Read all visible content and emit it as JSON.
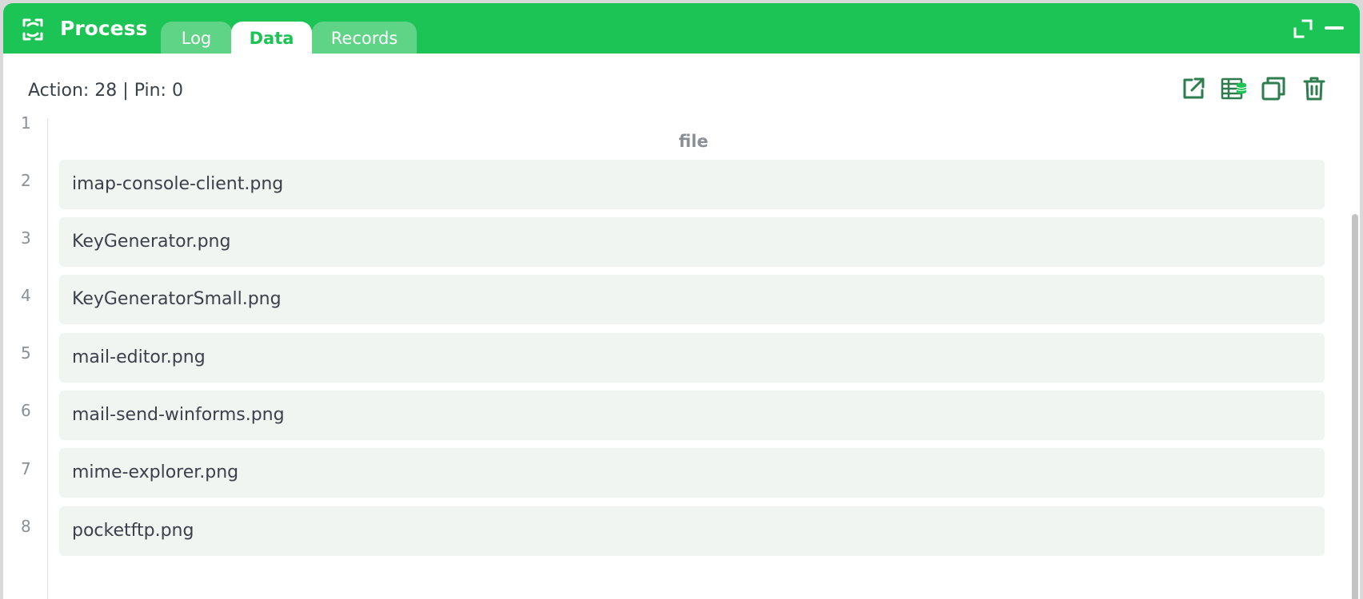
{
  "window": {
    "title": "Process",
    "app_icon": "refresh-arrows-icon",
    "controls": [
      "expand-icon",
      "minimize-icon"
    ]
  },
  "tabs": [
    {
      "label": "Log",
      "active": false
    },
    {
      "label": "Data",
      "active": true
    },
    {
      "label": "Records",
      "active": false
    }
  ],
  "status": {
    "text": "Action: 28 | Pin: 0"
  },
  "toolbar": {
    "icons": [
      "open-external-icon",
      "table-database-icon",
      "copy-icon",
      "trash-icon"
    ]
  },
  "table": {
    "header_line": "1",
    "column": "file",
    "rows": [
      {
        "line": "2",
        "value": "imap-console-client.png"
      },
      {
        "line": "3",
        "value": "KeyGenerator.png"
      },
      {
        "line": "4",
        "value": "KeyGeneratorSmall.png"
      },
      {
        "line": "5",
        "value": "mail-editor.png"
      },
      {
        "line": "6",
        "value": "mail-send-winforms.png"
      },
      {
        "line": "7",
        "value": "mime-explorer.png"
      },
      {
        "line": "8",
        "value": "pocketftp.png"
      }
    ]
  },
  "colors": {
    "accent": "#1bc454",
    "tab_inactive": "#5fd386",
    "icon": "#2e7d4f",
    "row_bg": "#f1f5f2"
  }
}
